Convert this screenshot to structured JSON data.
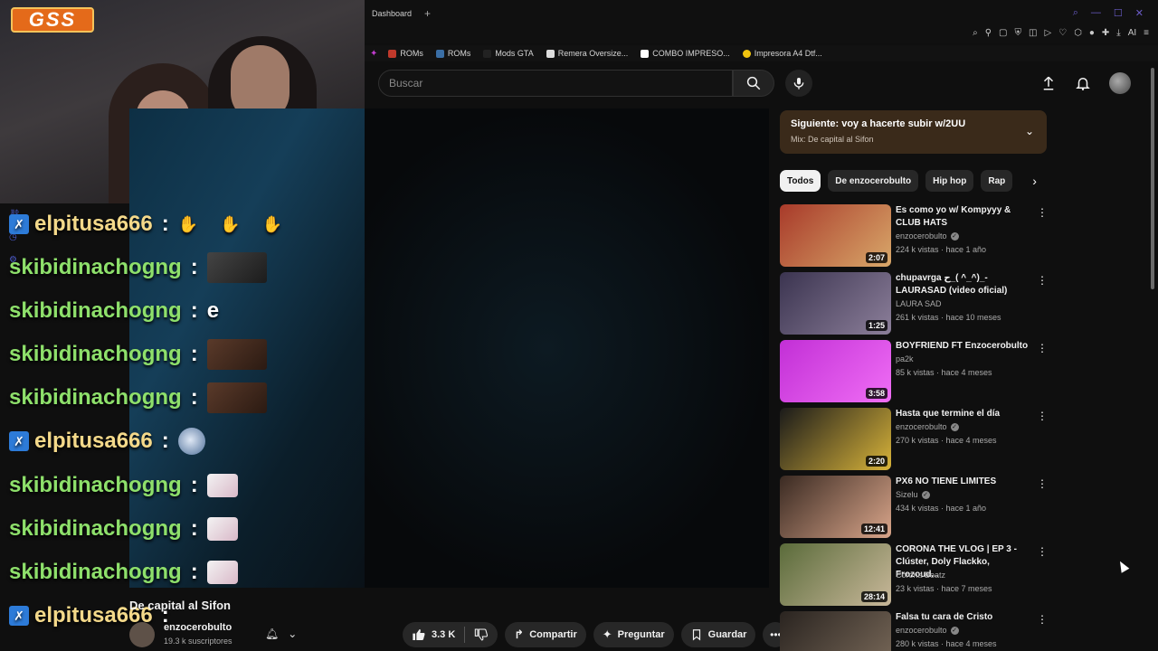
{
  "browser": {
    "tab_label": "Dashboard",
    "new_tab": "+",
    "bookmarks": [
      {
        "label": "ROMs",
        "color": "#c0392b"
      },
      {
        "label": "ROMs",
        "color": "#3a6ea5"
      },
      {
        "label": "Mods GTA",
        "color": "#222222"
      },
      {
        "label": "Remera Oversize...",
        "color": "#dddddd"
      },
      {
        "label": "COMBO IMPRESO...",
        "color": "#ffffff"
      },
      {
        "label": "Impresora A4 Dtf...",
        "color": "#f1c40f"
      }
    ],
    "ai_label": "AI"
  },
  "stream": {
    "logo_text": "GSS",
    "multiplier": "x3",
    "chat": [
      {
        "user": "elpitusa666",
        "message": "",
        "color": "yellow",
        "badge": true,
        "emote": "hands"
      },
      {
        "user": "skibidinachogng",
        "message": "",
        "color": "green",
        "badge": false,
        "emote": "image"
      },
      {
        "user": "skibidinachogng",
        "message": "e",
        "color": "green",
        "badge": false,
        "emote": ""
      },
      {
        "user": "skibidinachogng",
        "message": "",
        "color": "green",
        "badge": false,
        "emote": "face"
      },
      {
        "user": "skibidinachogng",
        "message": "",
        "color": "green",
        "badge": false,
        "emote": "face"
      },
      {
        "user": "elpitusa666",
        "message": "",
        "color": "yellow",
        "badge": true,
        "emote": "round"
      },
      {
        "user": "skibidinachogng",
        "message": "",
        "color": "green",
        "badge": false,
        "emote": "cat"
      },
      {
        "user": "skibidinachogng",
        "message": "",
        "color": "green",
        "badge": false,
        "emote": "cat"
      },
      {
        "user": "skibidinachogng",
        "message": "",
        "color": "green",
        "badge": false,
        "emote": "cat"
      },
      {
        "user": "elpitusa666",
        "message": "",
        "color": "yellow",
        "badge": true,
        "emote": ""
      }
    ],
    "colon": ":"
  },
  "youtube": {
    "search_placeholder": "Buscar",
    "video_title": "De capital al Sifon",
    "channel_name": "enzocerobulto",
    "subscribers": "19.3 k suscriptores",
    "likes": "3.3 K",
    "share_label": "Compartir",
    "ask_label": "Preguntar",
    "save_label": "Guardar",
    "next_up": {
      "title": "Siguiente: voy a hacerte subir w/2UU",
      "subtitle": "Mix: De capital al Sifon"
    },
    "chips": [
      "Todos",
      "De enzocerobulto",
      "Hip hop",
      "Rap"
    ],
    "recommendations": [
      {
        "title": "Es como yo w/ Kompyyy & CLUB HATS",
        "channel": "enzocerobulto",
        "verified": true,
        "meta": "224 k vistas · hace 1 año",
        "duration": "2:07",
        "thumb": [
          "#a83a2a",
          "#d9a86a"
        ]
      },
      {
        "title": "chupavrga ح_( ^_^)_- LAURASAD (video oficial)",
        "channel": "LAURA SAD",
        "verified": false,
        "meta": "261 k vistas · hace 10 meses",
        "duration": "1:25",
        "thumb": [
          "#3b3450",
          "#8c7f9a"
        ]
      },
      {
        "title": "BOYFRIEND FT Enzocerobulto",
        "channel": "pa2k",
        "verified": false,
        "meta": "85 k vistas · hace 4 meses",
        "duration": "3:58",
        "thumb": [
          "#c22fd6",
          "#f06ef5"
        ]
      },
      {
        "title": "Hasta que termine el día",
        "channel": "enzocerobulto",
        "verified": true,
        "meta": "270 k vistas · hace 4 meses",
        "duration": "2:20",
        "thumb": [
          "#1a1a1a",
          "#d9b43a"
        ]
      },
      {
        "title": "PX6 NO TIENE LIMITES",
        "channel": "Sizelu",
        "verified": true,
        "meta": "434 k vistas · hace 1 año",
        "duration": "12:41",
        "thumb": [
          "#3a2a22",
          "#d9a58a"
        ]
      },
      {
        "title": "CORONA THE VLOG | EP 3 - Clúster, Doly Flackko, Frozoud...",
        "channel": "Corona Beatz",
        "verified": false,
        "meta": "23 k vistas · hace 7 meses",
        "duration": "28:14",
        "thumb": [
          "#5a6b3a",
          "#c9b89a"
        ]
      },
      {
        "title": "Falsa tu cara de Cristo",
        "channel": "enzocerobulto",
        "verified": true,
        "meta": "280 k vistas · hace 4 meses",
        "duration": "",
        "thumb": [
          "#2a2420",
          "#7a6a5a"
        ]
      }
    ]
  }
}
